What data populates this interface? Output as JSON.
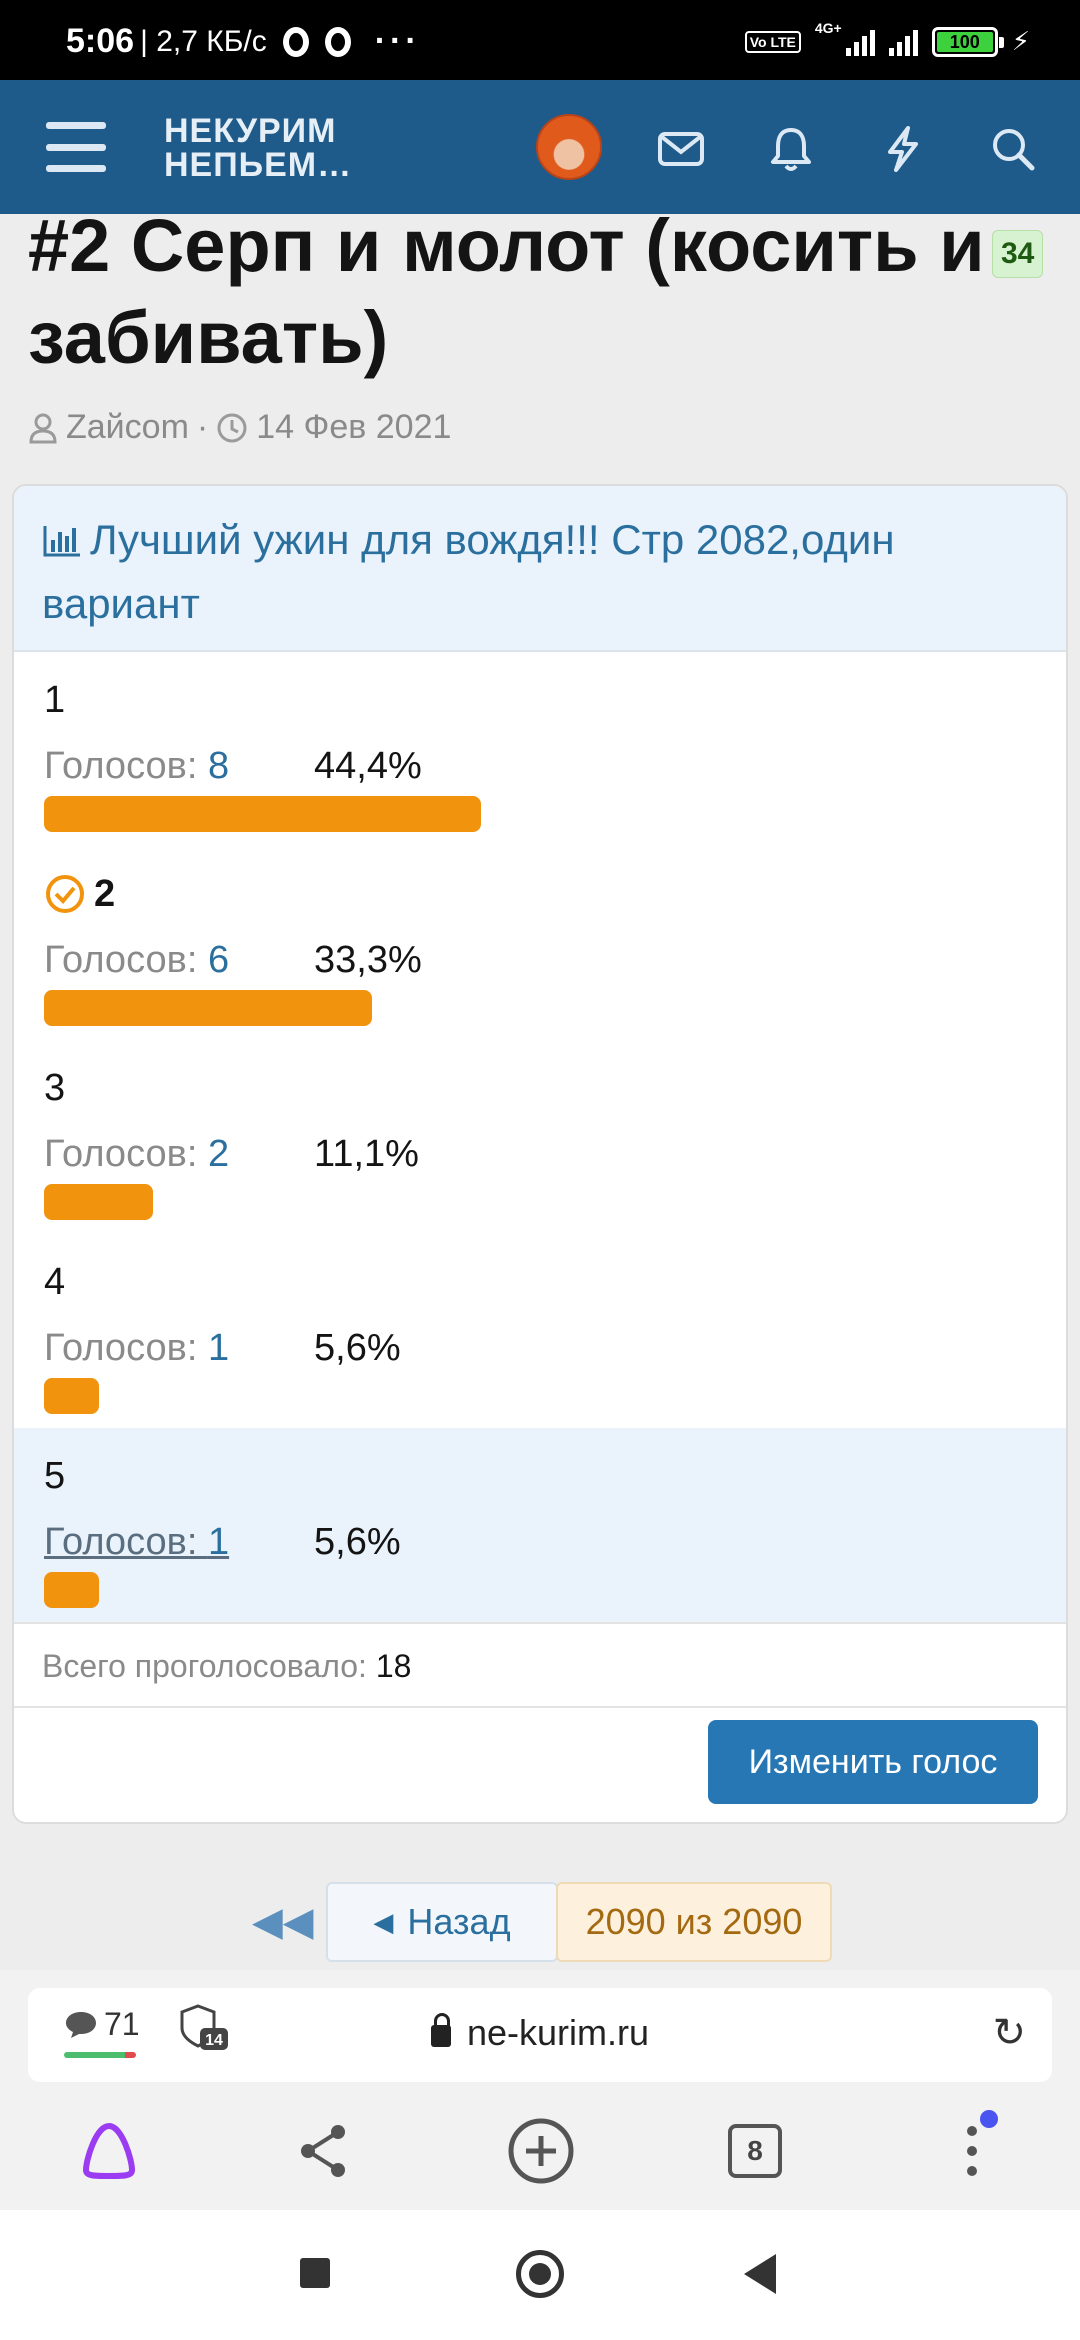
{
  "status_bar": {
    "time": "5:06",
    "speed": "| 2,7 КБ/с",
    "more": "···",
    "volte": "Vo LTE",
    "network": "4G+",
    "battery": "100"
  },
  "header": {
    "logo_line1": "НЕКУРИМ",
    "logo_line2": "НЕПЬЕМ…"
  },
  "thread": {
    "title": "#2 Серп и молот (косить и забивать)",
    "reply_count": "34",
    "author": "Zaйcom",
    "separator": "·",
    "date": "14 Фев 2021"
  },
  "poll": {
    "question": "Лучший ужин для вождя!!! Стр 2082,один вариант",
    "votes_label": "Голосов: ",
    "options": [
      {
        "label": "1",
        "votes": "8",
        "percent": "44,4%",
        "fraction": 0.444,
        "voted": false
      },
      {
        "label": "2",
        "votes": "6",
        "percent": "33,3%",
        "fraction": 0.333,
        "voted": true
      },
      {
        "label": "3",
        "votes": "2",
        "percent": "11,1%",
        "fraction": 0.111,
        "voted": false
      },
      {
        "label": "4",
        "votes": "1",
        "percent": "5,6%",
        "fraction": 0.056,
        "voted": false
      },
      {
        "label": "5",
        "votes": "1",
        "percent": "5,6%",
        "fraction": 0.056,
        "voted": false
      }
    ],
    "total_label": "Всего проголосовало: ",
    "total_value": "18",
    "change_vote_button": "Изменить голос"
  },
  "pagination": {
    "back_label": "Назад",
    "current": "2090 из 2090"
  },
  "browser": {
    "comments_count": "71",
    "shield_count": "14",
    "url": "ne-kurim.ru",
    "tabs_count": "8"
  },
  "colors": {
    "header_bg": "#1e5b8a",
    "accent": "#2b6f9e",
    "bar": "#f2930e",
    "button": "#2777b4"
  }
}
